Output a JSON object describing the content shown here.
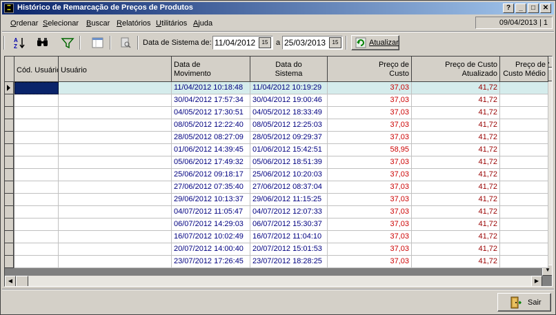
{
  "window": {
    "title": "Histórico de Remarcação de Preços de Produtos",
    "icon_text": "CMG"
  },
  "titlebar_buttons": {
    "help": "?",
    "minimize": "_",
    "maximize": "□",
    "close": "✕"
  },
  "menu": [
    {
      "label": "Ordenar",
      "ul": "O"
    },
    {
      "label": "Selecionar",
      "ul": "S"
    },
    {
      "label": "Buscar",
      "ul": "B"
    },
    {
      "label": "Relatórios",
      "ul": "R"
    },
    {
      "label": "Utilitários",
      "ul": "U"
    },
    {
      "label": "Ajuda",
      "ul": "A"
    }
  ],
  "status_date": "09/04/2013 | 1",
  "toolbar": {
    "date_label": "Data de Sistema de:",
    "date_from": "11/04/2012",
    "date_sep": "a",
    "date_to": "25/03/2013",
    "calendar_label": "15",
    "refresh_label": "Atualizar"
  },
  "columns": [
    {
      "label": "Cód. Usuário",
      "align": "left"
    },
    {
      "label": "Usuário",
      "align": "left"
    },
    {
      "label": "Data de\nMovimento",
      "align": "left"
    },
    {
      "label": "Data do\nSistema",
      "align": "center"
    },
    {
      "label": "Preço de\nCusto",
      "align": "right"
    },
    {
      "label": "Preço de Custo\nAtualizado",
      "align": "right"
    },
    {
      "label": "Preço de\nCusto Médio",
      "align": "right"
    }
  ],
  "rows": [
    [
      "",
      "",
      "11/04/2012 10:18:48",
      "11/04/2012 10:19:29",
      "37,03",
      "41,72",
      ""
    ],
    [
      "",
      "",
      "30/04/2012 17:57:34",
      "30/04/2012 19:00:46",
      "37,03",
      "41,72",
      ""
    ],
    [
      "",
      "",
      "04/05/2012 17:30:51",
      "04/05/2012 18:33:49",
      "37,03",
      "41,72",
      ""
    ],
    [
      "",
      "",
      "08/05/2012 12:22:40",
      "08/05/2012 12:25:03",
      "37,03",
      "41,72",
      ""
    ],
    [
      "",
      "",
      "28/05/2012 08:27:09",
      "28/05/2012 09:29:37",
      "37,03",
      "41,72",
      ""
    ],
    [
      "",
      "",
      "01/06/2012 14:39:45",
      "01/06/2012 15:42:51",
      "58,95",
      "41,72",
      ""
    ],
    [
      "",
      "",
      "05/06/2012 17:49:32",
      "05/06/2012 18:51:39",
      "37,03",
      "41,72",
      ""
    ],
    [
      "",
      "",
      "25/06/2012 09:18:17",
      "25/06/2012 10:20:03",
      "37,03",
      "41,72",
      ""
    ],
    [
      "",
      "",
      "27/06/2012 07:35:40",
      "27/06/2012 08:37:04",
      "37,03",
      "41,72",
      ""
    ],
    [
      "",
      "",
      "29/06/2012 10:13:37",
      "29/06/2012 11:15:25",
      "37,03",
      "41,72",
      ""
    ],
    [
      "",
      "",
      "04/07/2012 11:05:47",
      "04/07/2012 12:07:33",
      "37,03",
      "41,72",
      ""
    ],
    [
      "",
      "",
      "06/07/2012 14:29:03",
      "06/07/2012 15:30:37",
      "37,03",
      "41,72",
      ""
    ],
    [
      "",
      "",
      "16/07/2012 10:02:49",
      "16/07/2012 11:04:10",
      "37,03",
      "41,72",
      ""
    ],
    [
      "",
      "",
      "20/07/2012 14:00:40",
      "20/07/2012 15:01:53",
      "37,03",
      "41,72",
      ""
    ],
    [
      "",
      "",
      "23/07/2012 17:26:45",
      "23/07/2012 18:28:25",
      "37,03",
      "41,72",
      ""
    ]
  ],
  "colors": {
    "selected_row": "#d5ecec",
    "date_text": "#000080",
    "price_text": "#cc0000",
    "updated_price_text": "#990000"
  },
  "exit_button": {
    "label": "Sair"
  }
}
